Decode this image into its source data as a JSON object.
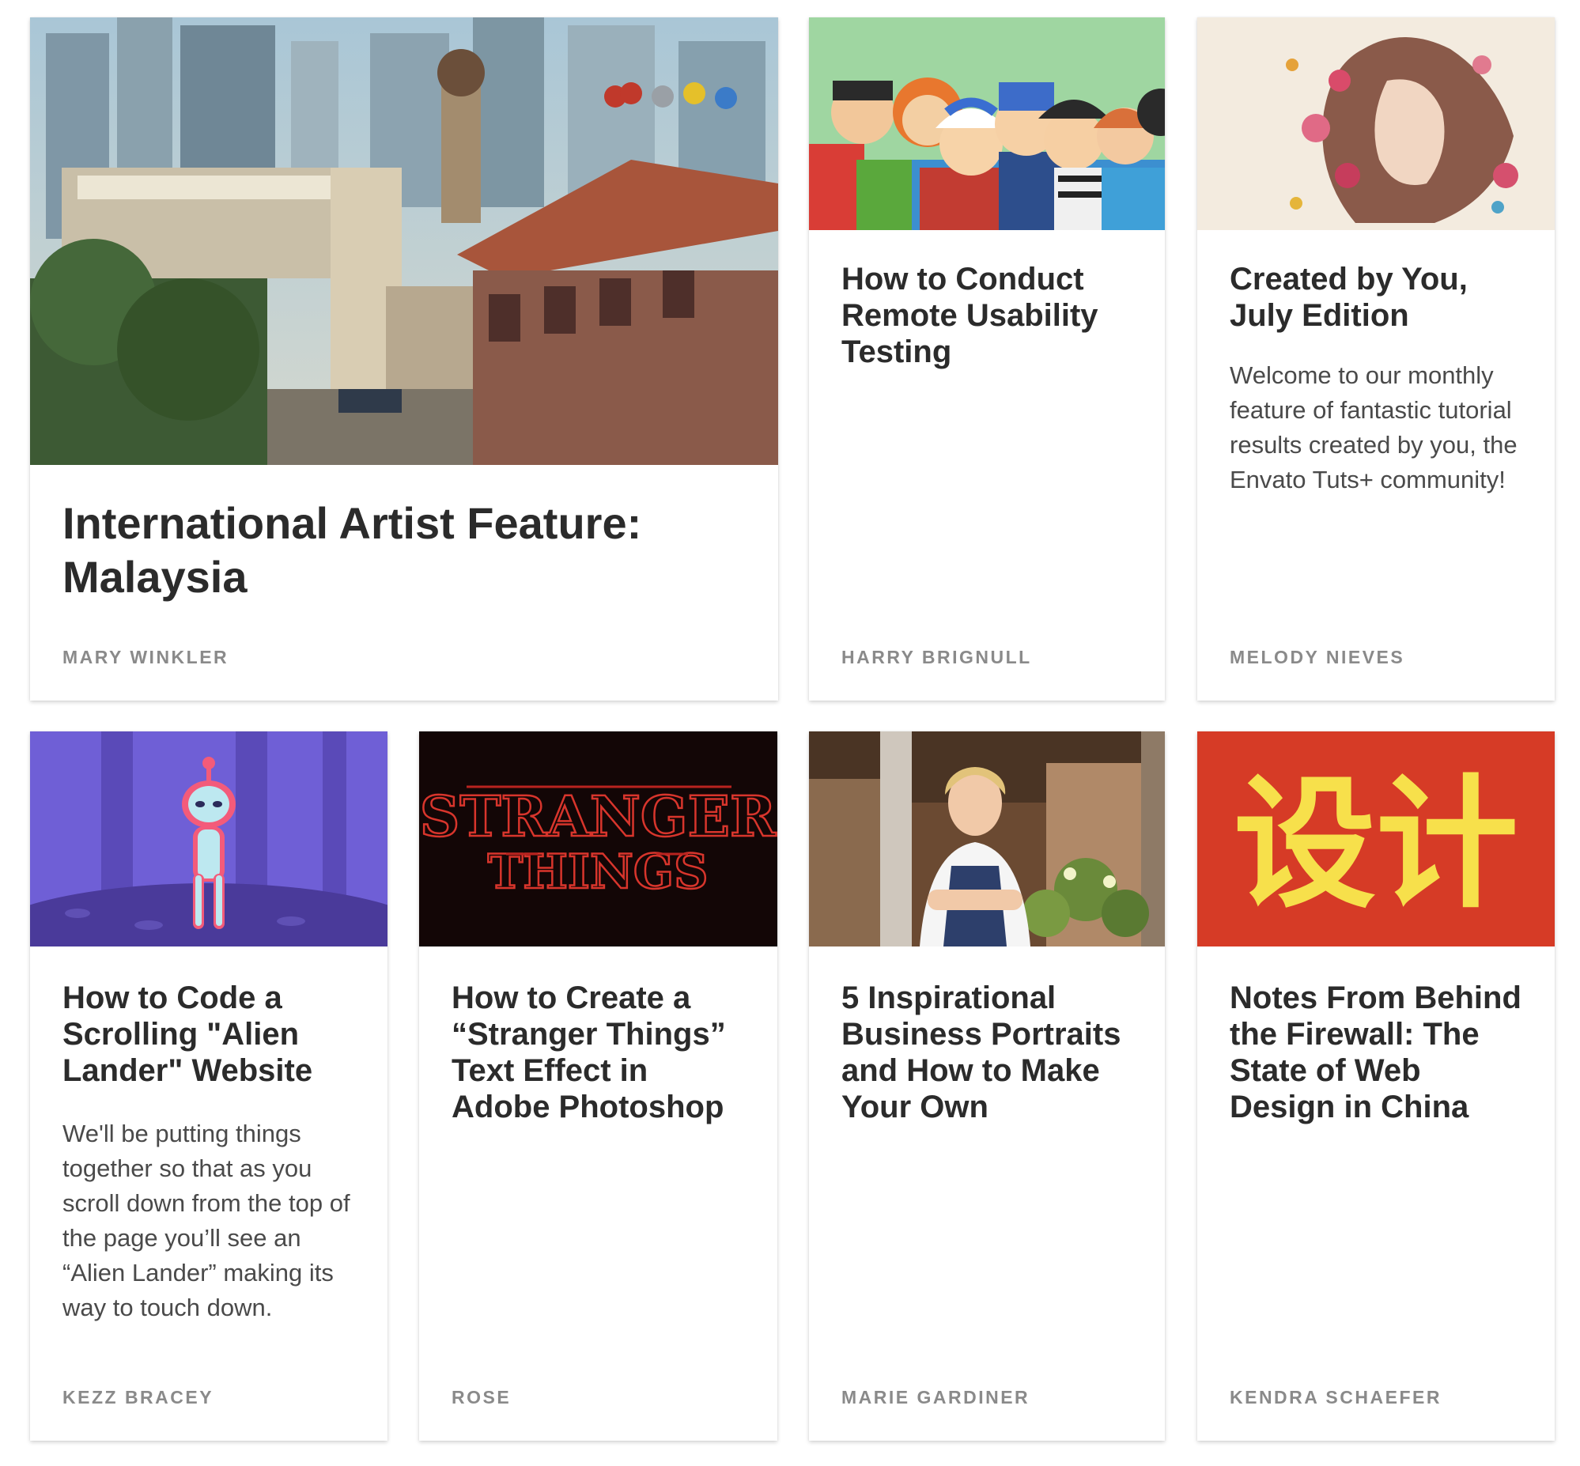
{
  "cards": [
    {
      "title": "International Artist Feature: Malaysia",
      "summary": "",
      "author": "MARY WINKLER",
      "image": "malaysia-street-illustration"
    },
    {
      "title": "How to Conduct Remote Usability Testing",
      "summary": "",
      "author": "HARRY BRIGNULL",
      "image": "crowd-of-people-illustration"
    },
    {
      "title": "Created by You, July Edition",
      "summary": "Welcome to our monthly feature of fantastic tutorial results created by you, the Envato Tuts+ community!",
      "author": "MELODY NIEVES",
      "image": "woman-with-flowers-illustration"
    },
    {
      "title": "How to Code a Scrolling \"Alien Lander\" Website",
      "summary": "We'll be putting things together so that as you scroll down from the top of the page you’ll see an “Alien Lander” making its way to touch down.",
      "author": "KEZZ BRACEY",
      "image": "alien-illustration"
    },
    {
      "title": "How to Create a “Stranger Things” Text Effect in Adobe Photoshop",
      "summary": "",
      "author": "ROSE",
      "image": "stranger-things-logo",
      "image_text": [
        "STRANGER",
        "THINGS"
      ]
    },
    {
      "title": "5 Inspirational Business Portraits and How to Make Your Own",
      "summary": "",
      "author": "MARIE GARDINER",
      "image": "florist-portrait-photo"
    },
    {
      "title": "Notes From Behind the Firewall: The State of Web Design in China",
      "summary": "",
      "author": "KENDRA SCHAEFER",
      "image": "chinese-characters-design",
      "image_text": "设计"
    }
  ],
  "colors": {
    "title": "#2b2b2b",
    "summary": "#4a4a4a",
    "author": "#8a8a8a",
    "china_red": "#d63b26",
    "china_yellow": "#f7e04b",
    "alien_purple": "#6f5fd6"
  }
}
